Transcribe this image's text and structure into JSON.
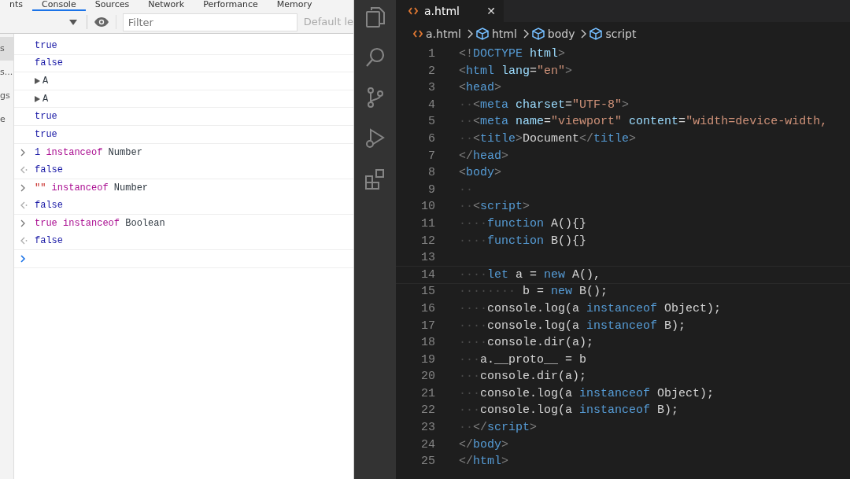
{
  "devtools": {
    "tabs": [
      {
        "label": "nts",
        "selected": false
      },
      {
        "label": "Console",
        "selected": true
      },
      {
        "label": "Sources",
        "selected": false
      },
      {
        "label": "Network",
        "selected": false
      },
      {
        "label": "Performance",
        "selected": false
      },
      {
        "label": "Memory",
        "selected": false
      }
    ],
    "filter": {
      "placeholder": "Filter"
    },
    "levels": "Default le",
    "sidebar": [
      {
        "label": "s",
        "selected": true
      },
      {
        "label": "s...",
        "selected": false
      },
      {
        "label": "gs",
        "selected": false
      },
      {
        "label": "e",
        "selected": false
      }
    ],
    "console": [
      {
        "kind": "value",
        "tokens": [
          {
            "kind": "bool",
            "text": "true"
          }
        ]
      },
      {
        "kind": "value",
        "tokens": [
          {
            "kind": "bool",
            "text": "false"
          }
        ]
      },
      {
        "kind": "object",
        "tokens": [
          {
            "kind": "name",
            "text": "A"
          }
        ]
      },
      {
        "kind": "object",
        "tokens": [
          {
            "kind": "name",
            "text": "A"
          }
        ]
      },
      {
        "kind": "value",
        "tokens": [
          {
            "kind": "bool",
            "text": "true"
          }
        ]
      },
      {
        "kind": "value",
        "tokens": [
          {
            "kind": "bool",
            "text": "true"
          }
        ]
      },
      {
        "kind": "input",
        "tokens": [
          {
            "kind": "num",
            "text": "1"
          },
          {
            "kind": "kw",
            "text": " instanceof"
          },
          {
            "kind": "name",
            "text": " Number"
          }
        ]
      },
      {
        "kind": "output",
        "tokens": [
          {
            "kind": "bool",
            "text": "false"
          }
        ]
      },
      {
        "kind": "input",
        "tokens": [
          {
            "kind": "str",
            "text": "\"\""
          },
          {
            "kind": "kw",
            "text": " instanceof"
          },
          {
            "kind": "name",
            "text": " Number"
          }
        ]
      },
      {
        "kind": "output",
        "tokens": [
          {
            "kind": "bool",
            "text": "false"
          }
        ]
      },
      {
        "kind": "input",
        "tokens": [
          {
            "kind": "kw",
            "text": "true"
          },
          {
            "kind": "kw",
            "text": " instanceof"
          },
          {
            "kind": "name",
            "text": " Boolean"
          }
        ]
      },
      {
        "kind": "output",
        "tokens": [
          {
            "kind": "bool",
            "text": "false"
          }
        ]
      },
      {
        "kind": "prompt"
      }
    ]
  },
  "editor": {
    "tab": {
      "label": "a.html",
      "close": "✕"
    },
    "breadcrumb": [
      {
        "label": "a.html",
        "kind": "file"
      },
      {
        "label": "html",
        "kind": "element"
      },
      {
        "label": "body",
        "kind": "element"
      },
      {
        "label": "script",
        "kind": "element"
      }
    ],
    "lines": [
      {
        "n": "1",
        "current": false,
        "tokens": [
          {
            "kind": "punct",
            "text": "<!"
          },
          {
            "kind": "tag",
            "text": "DOCTYPE"
          },
          {
            "kind": "attr",
            "text": " html"
          },
          {
            "kind": "punct",
            "text": ">"
          }
        ]
      },
      {
        "n": "2",
        "current": false,
        "tokens": [
          {
            "kind": "punct",
            "text": "<"
          },
          {
            "kind": "tag",
            "text": "html"
          },
          {
            "kind": "attr",
            "text": " lang"
          },
          {
            "kind": "text",
            "text": "="
          },
          {
            "kind": "str",
            "text": "\"en\""
          },
          {
            "kind": "punct",
            "text": ">"
          }
        ]
      },
      {
        "n": "3",
        "current": false,
        "tokens": [
          {
            "kind": "punct",
            "text": "<"
          },
          {
            "kind": "tag",
            "text": "head"
          },
          {
            "kind": "punct",
            "text": ">"
          }
        ]
      },
      {
        "n": "4",
        "current": false,
        "tokens": [
          {
            "kind": "ws",
            "text": "··"
          },
          {
            "kind": "punct",
            "text": "<"
          },
          {
            "kind": "tag",
            "text": "meta"
          },
          {
            "kind": "attr",
            "text": " charset"
          },
          {
            "kind": "text",
            "text": "="
          },
          {
            "kind": "str",
            "text": "\"UTF-8\""
          },
          {
            "kind": "punct",
            "text": ">"
          }
        ]
      },
      {
        "n": "5",
        "current": false,
        "tokens": [
          {
            "kind": "ws",
            "text": "··"
          },
          {
            "kind": "punct",
            "text": "<"
          },
          {
            "kind": "tag",
            "text": "meta"
          },
          {
            "kind": "attr",
            "text": " name"
          },
          {
            "kind": "text",
            "text": "="
          },
          {
            "kind": "str",
            "text": "\"viewport\""
          },
          {
            "kind": "attr",
            "text": " content"
          },
          {
            "kind": "text",
            "text": "="
          },
          {
            "kind": "str",
            "text": "\"width=device-width,"
          }
        ]
      },
      {
        "n": "6",
        "current": false,
        "tokens": [
          {
            "kind": "ws",
            "text": "··"
          },
          {
            "kind": "punct",
            "text": "<"
          },
          {
            "kind": "tag",
            "text": "title"
          },
          {
            "kind": "punct",
            "text": ">"
          },
          {
            "kind": "text",
            "text": "Document"
          },
          {
            "kind": "punct",
            "text": "</"
          },
          {
            "kind": "tag",
            "text": "title"
          },
          {
            "kind": "punct",
            "text": ">"
          }
        ]
      },
      {
        "n": "7",
        "current": false,
        "tokens": [
          {
            "kind": "punct",
            "text": "</"
          },
          {
            "kind": "tag",
            "text": "head"
          },
          {
            "kind": "punct",
            "text": ">"
          }
        ]
      },
      {
        "n": "8",
        "current": false,
        "tokens": [
          {
            "kind": "punct",
            "text": "<"
          },
          {
            "kind": "tag",
            "text": "body"
          },
          {
            "kind": "punct",
            "text": ">"
          }
        ]
      },
      {
        "n": "9",
        "current": false,
        "tokens": [
          {
            "kind": "ws",
            "text": "··"
          }
        ]
      },
      {
        "n": "10",
        "current": false,
        "tokens": [
          {
            "kind": "ws",
            "text": "··"
          },
          {
            "kind": "punct",
            "text": "<"
          },
          {
            "kind": "tag",
            "text": "script"
          },
          {
            "kind": "punct",
            "text": ">"
          }
        ]
      },
      {
        "n": "11",
        "current": false,
        "tokens": [
          {
            "kind": "ws",
            "text": "····"
          },
          {
            "kind": "kw",
            "text": "function"
          },
          {
            "kind": "text",
            "text": " A(){}"
          }
        ]
      },
      {
        "n": "12",
        "current": false,
        "tokens": [
          {
            "kind": "ws",
            "text": "····"
          },
          {
            "kind": "kw",
            "text": "function"
          },
          {
            "kind": "text",
            "text": " B(){}"
          }
        ]
      },
      {
        "n": "13",
        "current": false
      },
      {
        "n": "14",
        "current": true,
        "tokens": [
          {
            "kind": "ws",
            "text": "····"
          },
          {
            "kind": "kw",
            "text": "let"
          },
          {
            "kind": "text",
            "text": " a = "
          },
          {
            "kind": "kw",
            "text": "new"
          },
          {
            "kind": "text",
            "text": " A(),"
          }
        ]
      },
      {
        "n": "15",
        "current": false,
        "tokens": [
          {
            "kind": "ws",
            "text": "········"
          },
          {
            "kind": "text",
            "text": " b = "
          },
          {
            "kind": "kw",
            "text": "new"
          },
          {
            "kind": "text",
            "text": " B();"
          }
        ]
      },
      {
        "n": "16",
        "current": false,
        "tokens": [
          {
            "kind": "ws",
            "text": "····"
          },
          {
            "kind": "text",
            "text": "console.log(a "
          },
          {
            "kind": "kw",
            "text": "instanceof"
          },
          {
            "kind": "text",
            "text": " Object);"
          }
        ]
      },
      {
        "n": "17",
        "current": false,
        "tokens": [
          {
            "kind": "ws",
            "text": "····"
          },
          {
            "kind": "text",
            "text": "console.log(a "
          },
          {
            "kind": "kw",
            "text": "instanceof"
          },
          {
            "kind": "text",
            "text": " B);"
          }
        ]
      },
      {
        "n": "18",
        "current": false,
        "tokens": [
          {
            "kind": "ws",
            "text": "····"
          },
          {
            "kind": "text",
            "text": "console.dir(a);"
          }
        ]
      },
      {
        "n": "19",
        "current": false,
        "tokens": [
          {
            "kind": "ws",
            "text": "···"
          },
          {
            "kind": "text",
            "text": "a.__proto__ = b"
          }
        ]
      },
      {
        "n": "20",
        "current": false,
        "tokens": [
          {
            "kind": "ws",
            "text": "···"
          },
          {
            "kind": "text",
            "text": "console.dir(a);"
          }
        ]
      },
      {
        "n": "21",
        "current": false,
        "tokens": [
          {
            "kind": "ws",
            "text": "···"
          },
          {
            "kind": "text",
            "text": "console.log(a "
          },
          {
            "kind": "kw",
            "text": "instanceof"
          },
          {
            "kind": "text",
            "text": " Object);"
          }
        ]
      },
      {
        "n": "22",
        "current": false,
        "tokens": [
          {
            "kind": "ws",
            "text": "···"
          },
          {
            "kind": "text",
            "text": "console.log(a "
          },
          {
            "kind": "kw",
            "text": "instanceof"
          },
          {
            "kind": "text",
            "text": " B);"
          }
        ]
      },
      {
        "n": "23",
        "current": false,
        "tokens": [
          {
            "kind": "ws",
            "text": "··"
          },
          {
            "kind": "punct",
            "text": "</"
          },
          {
            "kind": "tag",
            "text": "script"
          },
          {
            "kind": "punct",
            "text": ">"
          }
        ]
      },
      {
        "n": "24",
        "current": false,
        "tokens": [
          {
            "kind": "punct",
            "text": "</"
          },
          {
            "kind": "tag",
            "text": "body"
          },
          {
            "kind": "punct",
            "text": ">"
          }
        ]
      },
      {
        "n": "25",
        "current": false,
        "tokens": [
          {
            "kind": "punct",
            "text": "</"
          },
          {
            "kind": "tag",
            "text": "html"
          },
          {
            "kind": "punct",
            "text": ">"
          }
        ]
      }
    ]
  }
}
